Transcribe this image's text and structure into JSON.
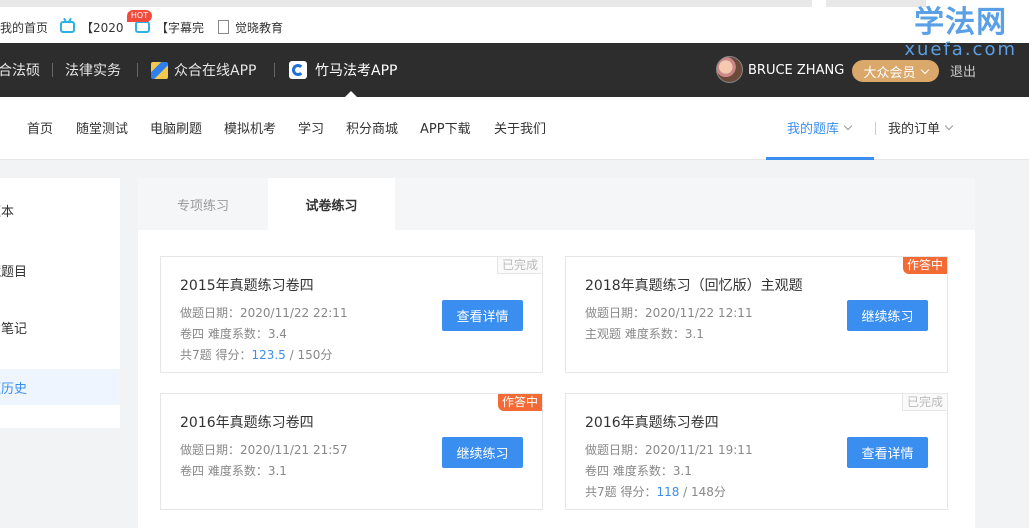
{
  "bookmarks": {
    "items": [
      {
        "label": "我的首页",
        "icon": "none"
      },
      {
        "label": "【2020",
        "icon": "bilibili-tv-icon"
      },
      {
        "label": "【字幕完",
        "icon": "bilibili-tv-icon"
      },
      {
        "label": "觉晓教育",
        "icon": "page-icon"
      }
    ]
  },
  "logo": {
    "cn": "学法网",
    "en": "xuefa.com",
    "color": "#5aa0e6"
  },
  "topbar": {
    "items": [
      "合法硕",
      "法律实务",
      "众合在线APP",
      "竹马法考APP"
    ],
    "user_name": "BRUCE ZHANG",
    "vip_label": "大众会员",
    "logout_label": "退出"
  },
  "mainnav": {
    "items": [
      "首页",
      "随堂测试",
      "电脑刷题",
      "模拟机考",
      "学习",
      "积分商城",
      "APP下载",
      "关于我们"
    ],
    "hot_badge": "HOT",
    "my_bank": "我的题库",
    "my_orders": "我的订单"
  },
  "sidebar": {
    "items": [
      "题本",
      "藏题目",
      "的笔记",
      "题历史"
    ],
    "active_index": 3
  },
  "tabs": {
    "special": "专项练习",
    "paper": "试卷练习"
  },
  "cards": [
    {
      "title": "2015年真题练习卷四",
      "date_label": "做题日期：",
      "date": "2020/11/22 22:11",
      "meta": "卷四 难度系数：3.4",
      "score_prefix": "共7题  得分：",
      "score": "123.5",
      "score_total": " / 150分",
      "status": "已完成",
      "button": "查看详情"
    },
    {
      "title": "2018年真题练习（回忆版）主观题",
      "date_label": "做题日期：",
      "date": "2020/11/22 12:11",
      "meta": "主观题 难度系数：3.1",
      "status": "作答中",
      "button": "继续练习"
    },
    {
      "title": "2016年真题练习卷四",
      "date_label": "做题日期：",
      "date": "2020/11/21 21:57",
      "meta": "卷四 难度系数：3.1",
      "status": "作答中",
      "button": "继续练习"
    },
    {
      "title": "2016年真题练习卷四",
      "date_label": "做题日期：",
      "date": "2020/11/21 19:11",
      "meta": "卷四 难度系数：3.1",
      "score_prefix": "共7题  得分：",
      "score": "118",
      "score_total": " / 148分",
      "status": "已完成",
      "button": "查看详情"
    }
  ],
  "colors": {
    "accent": "#3a8ef0",
    "doing_badge": "#f36a35",
    "vip": "#d9a86a",
    "topbar": "#2d2d2d",
    "hot": "#f24b3c"
  }
}
